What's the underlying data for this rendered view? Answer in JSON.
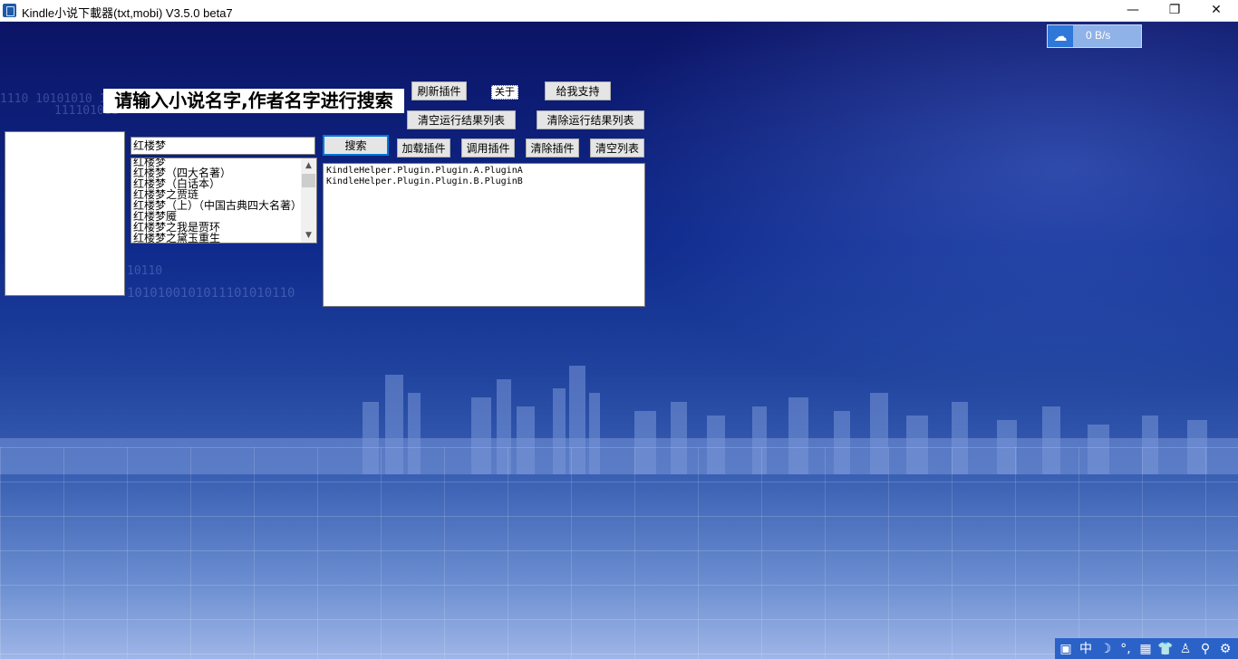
{
  "window": {
    "title": "Kindle小说下載器(txt,mobi) V3.5.0 beta7",
    "minimize": "—",
    "maximize": "❐",
    "close": "✕"
  },
  "speed_widget": {
    "text": "0 B/s",
    "icon": "cloud-icon"
  },
  "prompt": "请输入小说名字,作者名字进行搜索",
  "buttons": {
    "refresh_plugins": "刷新插件",
    "about": "关于",
    "support": "给我支持",
    "clear_results": "清空运行结果列表",
    "remove_results": "清除运行结果列表",
    "search": "搜索",
    "load_plugin": "加载插件",
    "call_plugin": "调用插件",
    "remove_plugin": "清除插件",
    "clear_list": "清空列表"
  },
  "search": {
    "value": "红楼梦"
  },
  "results": [
    "红楼梦",
    "红楼梦（四大名著）",
    "红楼梦（白话本）",
    "红楼梦之贾琏",
    "红楼梦（上）（中国古典四大名著）",
    "红楼梦魇",
    "红楼梦之我是贾环",
    "红楼梦之黛玉重生"
  ],
  "plugins": [
    "KindleHelper.Plugin.Plugin.A.PluginA",
    "KindleHelper.Plugin.Plugin.B.PluginB"
  ],
  "background_text": {
    "bin1": "1110    10101010  10",
    "bin2": "111101011",
    "bin3": "10110",
    "bin4": "1010100101011101010110"
  },
  "tray_icons": [
    "中",
    "☽",
    "°,",
    "▦",
    "👕",
    "♙",
    "⚲",
    "⚙"
  ]
}
